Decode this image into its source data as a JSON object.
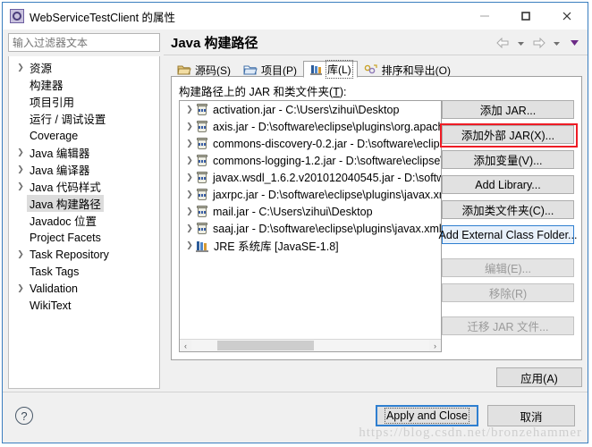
{
  "window": {
    "title": "WebServiceTestClient 的属性",
    "icon": "properties-icon",
    "minimize_label": "最小化",
    "maximize_label": "最大化",
    "close_label": "关闭"
  },
  "sidebar": {
    "filter": {
      "placeholder": "输入过滤器文本",
      "value": ""
    },
    "items": [
      {
        "label": "资源",
        "expandable": true,
        "selected": false
      },
      {
        "label": "构建器",
        "expandable": false,
        "selected": false
      },
      {
        "label": "项目引用",
        "expandable": false,
        "selected": false
      },
      {
        "label": "运行 / 调试设置",
        "expandable": false,
        "selected": false
      },
      {
        "label": "Coverage",
        "expandable": false,
        "selected": false
      },
      {
        "label": "Java 编辑器",
        "expandable": true,
        "selected": false
      },
      {
        "label": "Java 编译器",
        "expandable": true,
        "selected": false
      },
      {
        "label": "Java 代码样式",
        "expandable": true,
        "selected": false
      },
      {
        "label": "Java 构建路径",
        "expandable": false,
        "selected": true
      },
      {
        "label": "Javadoc 位置",
        "expandable": false,
        "selected": false
      },
      {
        "label": "Project Facets",
        "expandable": false,
        "selected": false
      },
      {
        "label": "Task Repository",
        "expandable": true,
        "selected": false
      },
      {
        "label": "Task Tags",
        "expandable": false,
        "selected": false
      },
      {
        "label": "Validation",
        "expandable": true,
        "selected": false
      },
      {
        "label": "WikiText",
        "expandable": false,
        "selected": false
      }
    ]
  },
  "page": {
    "title": "Java 构建路径",
    "nav": {
      "back": "back-arrow",
      "back_menu": "back-dropdown",
      "forward": "forward-arrow",
      "forward_menu": "forward-dropdown",
      "view_menu": "view-menu-dropdown"
    }
  },
  "tabs": [
    {
      "label": "源码(S)",
      "icon": "source-folder-icon",
      "active": false
    },
    {
      "label": "项目(P)",
      "icon": "project-folder-icon",
      "active": false
    },
    {
      "label": "库(L)",
      "icon": "library-icon",
      "active": true
    },
    {
      "label": "排序和导出(O)",
      "icon": "order-export-icon",
      "active": false
    }
  ],
  "library_tab": {
    "list_label_prefix": "构建路径上的 JAR 和类文件夹(",
    "list_label_mnemonic": "T",
    "list_label_suffix": "):",
    "entries": [
      {
        "name": "activation.jar",
        "separator": "-",
        "path": "C:\\Users\\zihui\\Desktop",
        "icon": "jar-icon"
      },
      {
        "name": "axis.jar",
        "separator": "-",
        "path": "D:\\software\\eclipse\\plugins\\org.apache",
        "icon": "jar-icon"
      },
      {
        "name": "commons-discovery-0.2.jar",
        "separator": "-",
        "path": "D:\\software\\eclipse\\",
        "icon": "jar-icon"
      },
      {
        "name": "commons-logging-1.2.jar",
        "separator": "-",
        "path": "D:\\software\\eclipse\\p",
        "icon": "jar-icon"
      },
      {
        "name": "javax.wsdl_1.6.2.v201012040545.jar",
        "separator": "-",
        "path": "D:\\software\\",
        "icon": "jar-icon"
      },
      {
        "name": "jaxrpc.jar",
        "separator": "-",
        "path": "D:\\software\\eclipse\\plugins\\javax.xml.",
        "icon": "jar-icon"
      },
      {
        "name": "mail.jar",
        "separator": "-",
        "path": "C:\\Users\\zihui\\Desktop",
        "icon": "jar-icon"
      },
      {
        "name": "saaj.jar",
        "separator": "-",
        "path": "D:\\software\\eclipse\\plugins\\javax.xml.sc",
        "icon": "jar-icon"
      },
      {
        "name": "JRE 系统库 [JavaSE-1.8]",
        "separator": "",
        "path": "",
        "icon": "library-stack-icon"
      }
    ],
    "scrollbar": {
      "left_arrow": "‹",
      "right_arrow": "›",
      "thumb_start_pct": 10,
      "thumb_width_pct": 37
    },
    "buttons": [
      {
        "label": "添加 JAR...",
        "mnemonic": "J",
        "state": "normal",
        "highlight": "none"
      },
      {
        "label": "添加外部 JAR(X)...",
        "mnemonic": "X",
        "state": "normal",
        "highlight": "red-box"
      },
      {
        "label": "添加变量(V)...",
        "mnemonic": "V",
        "state": "normal",
        "highlight": "none"
      },
      {
        "label": "Add Library...",
        "mnemonic": "b",
        "state": "normal",
        "highlight": "none"
      },
      {
        "label": "添加类文件夹(C)...",
        "mnemonic": "C",
        "state": "normal",
        "highlight": "none"
      },
      {
        "label": "Add External Class Folder...",
        "mnemonic": "d",
        "state": "normal",
        "highlight": "focus-blue"
      },
      {
        "label": "编辑(E)...",
        "mnemonic": "E",
        "state": "disabled",
        "highlight": "none"
      },
      {
        "label": "移除(R)",
        "mnemonic": "R",
        "state": "disabled",
        "highlight": "none"
      },
      {
        "label": "迁移 JAR 文件...",
        "mnemonic": "",
        "state": "disabled",
        "highlight": "none"
      }
    ],
    "apply_label": "应用(A)"
  },
  "footer": {
    "help_glyph": "?",
    "help_name": "help-button",
    "apply_and_close": "Apply and Close",
    "cancel": "取消"
  },
  "watermark": "https://blog.csdn.net/bronzehammer",
  "colors": {
    "accent": "#2f7fd0",
    "highlight_red": "#ee1c25",
    "window_border": "#3a7ebf",
    "panel_bg": "#f0f0f0",
    "selection": "#dcdcdc"
  }
}
